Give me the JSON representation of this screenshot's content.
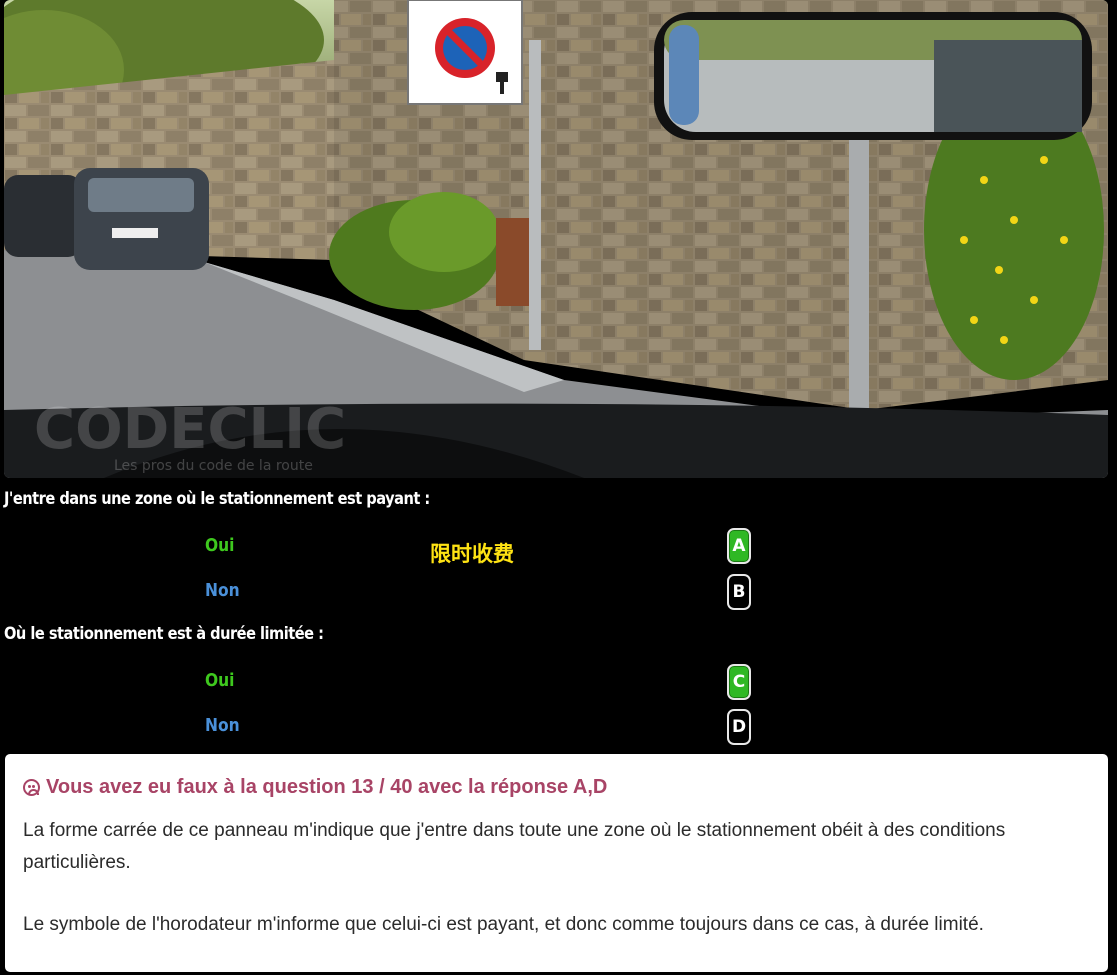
{
  "photo": {
    "watermark": "CODECLIC",
    "watermark_sub": "Les pros du code de la route",
    "plate": "AB-123-CD"
  },
  "questions": [
    {
      "title": "J'entre dans une zone où le stationnement est payant :",
      "options": [
        {
          "label": "Oui",
          "key": "A",
          "selected": true
        },
        {
          "label": "Non",
          "key": "B",
          "selected": false
        }
      ]
    },
    {
      "title": "Où le stationnement est à durée limitée :",
      "options": [
        {
          "label": "Oui",
          "key": "C",
          "selected": true
        },
        {
          "label": "Non",
          "key": "D",
          "selected": false
        }
      ]
    }
  ],
  "annotation": "限时收费",
  "feedback": {
    "headline": "Vous avez eu faux à la question 13 / 40 avec la réponse A,D",
    "icon": "sad-face-icon",
    "paragraph1": "La forme carrée de ce panneau m'indique que j'entre dans toute une zone où le stationnement obéit à des conditions particulières.",
    "paragraph2": "Le symbole de l'horodateur m'informe que celui-ci est payant, et donc comme toujours dans ce cas, à durée limité."
  },
  "colors": {
    "correct": "#3ec81e",
    "wrong": "#4a90d9",
    "error_text": "#a84466",
    "annotation": "#ffe313"
  }
}
